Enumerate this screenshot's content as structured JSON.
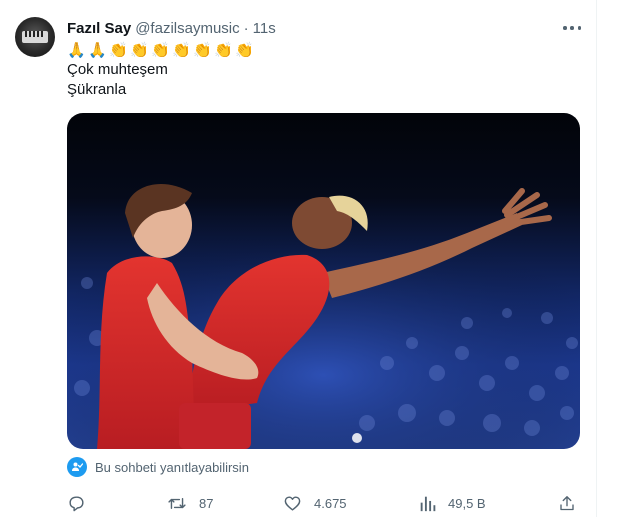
{
  "tweet": {
    "author_name": "Fazıl Say",
    "author_handle": "@fazilsaymusic",
    "separator": "·",
    "timestamp": "11s",
    "emoji_line": "🙏🙏👏🏻👏🏻👏🏻👏🏻👏🏻👏🏻👏🏻",
    "text_line_1": "Çok muhteşem",
    "text_line_2": "Şükranla",
    "reply_restriction": "Bu sohbeti yanıtlayabilirsin"
  },
  "metrics": {
    "retweets": "87",
    "likes": "4.675",
    "views": "49,5 B"
  },
  "icons": {
    "more": "more-icon",
    "reply": "reply-icon",
    "retweet": "retweet-icon",
    "like": "heart-icon",
    "views": "views-icon",
    "share": "share-icon",
    "reply_restriction": "people-check-icon"
  },
  "colors": {
    "text_primary": "#0f1419",
    "text_secondary": "#536471",
    "accent": "#1d9bf0",
    "jersey_red": "#d8262c"
  }
}
